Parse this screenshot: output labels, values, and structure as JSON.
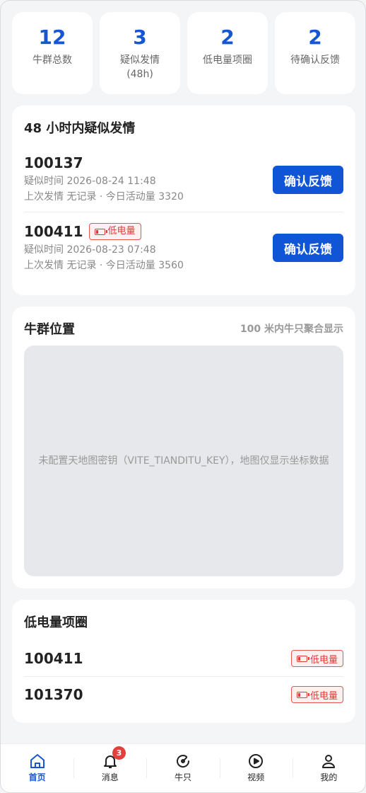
{
  "stats": [
    {
      "value": "12",
      "label": "牛群总数"
    },
    {
      "value": "3",
      "label": "疑似发情\n(48h)"
    },
    {
      "value": "2",
      "label": "低电量项圈"
    },
    {
      "value": "2",
      "label": "待确认反馈"
    }
  ],
  "estrus": {
    "title": "48 小时内疑似发情",
    "items": [
      {
        "id": "100137",
        "time": "疑似时间 2026-08-24 11:48",
        "info": "上次发情 无记录 · 今日活动量 3320",
        "low_battery": false,
        "button": "确认反馈"
      },
      {
        "id": "100411",
        "time": "疑似时间 2026-08-23 07:48",
        "info": "上次发情 无记录 · 今日活动量 3560",
        "low_battery": true,
        "badge": "低电量",
        "button": "确认反馈"
      }
    ]
  },
  "map": {
    "title": "牛群位置",
    "hint": "100 米内牛只聚合显示",
    "placeholder": "未配置天地图密钥（VITE_TIANDITU_KEY），地图仅显示坐标数据"
  },
  "low_battery": {
    "title": "低电量项圈",
    "items": [
      {
        "id": "100411",
        "badge": "低电量"
      },
      {
        "id": "101370",
        "badge": "低电量"
      }
    ]
  },
  "tabbar": {
    "items": [
      {
        "label": "首页",
        "icon": "home-icon",
        "active": true
      },
      {
        "label": "消息",
        "icon": "bell-icon",
        "badge": "3"
      },
      {
        "label": "牛只",
        "icon": "gauge-icon"
      },
      {
        "label": "视频",
        "icon": "play-icon"
      },
      {
        "label": "我的",
        "icon": "user-icon"
      }
    ]
  },
  "colors": {
    "accent": "#1656d3",
    "button": "#0f55d6",
    "danger": "#e03a36"
  }
}
